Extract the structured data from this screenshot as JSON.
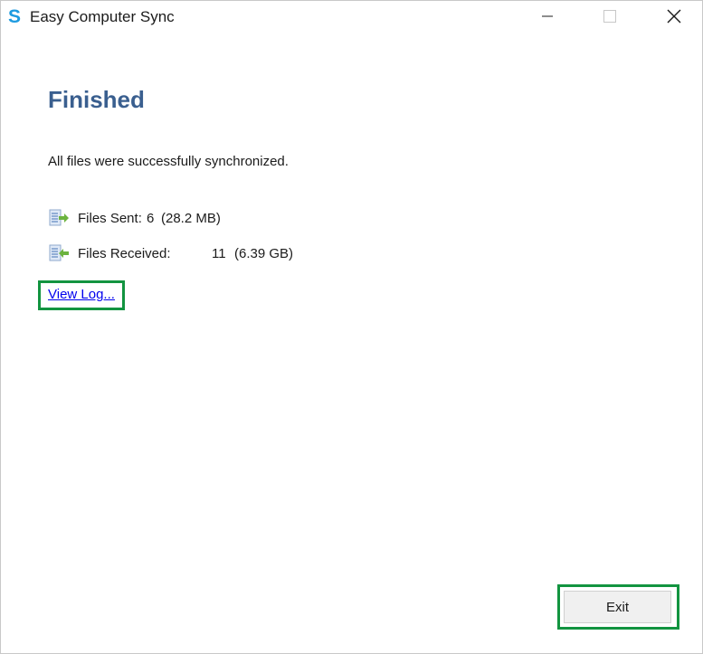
{
  "window": {
    "title": "Easy Computer Sync",
    "app_icon_letter": "S"
  },
  "titlebar_buttons": {
    "minimize_icon": "minimize-icon",
    "maximize_icon": "maximize-icon",
    "close_icon": "close-icon"
  },
  "content": {
    "heading": "Finished",
    "message": "All files were successfully synchronized.",
    "files_sent": {
      "label": "Files Sent:",
      "count": "6",
      "size": "(28.2 MB)",
      "icon": "file-send-icon"
    },
    "files_received": {
      "label": "Files Received:",
      "count": "11",
      "size": "(6.39 GB)",
      "icon": "file-receive-icon"
    },
    "view_log_label": "View Log..."
  },
  "footer": {
    "exit_label": "Exit"
  },
  "colors": {
    "heading": "#3a5f8f",
    "highlight_border": "#129440",
    "link": "#0000ee",
    "app_icon": "#1e9be0"
  }
}
